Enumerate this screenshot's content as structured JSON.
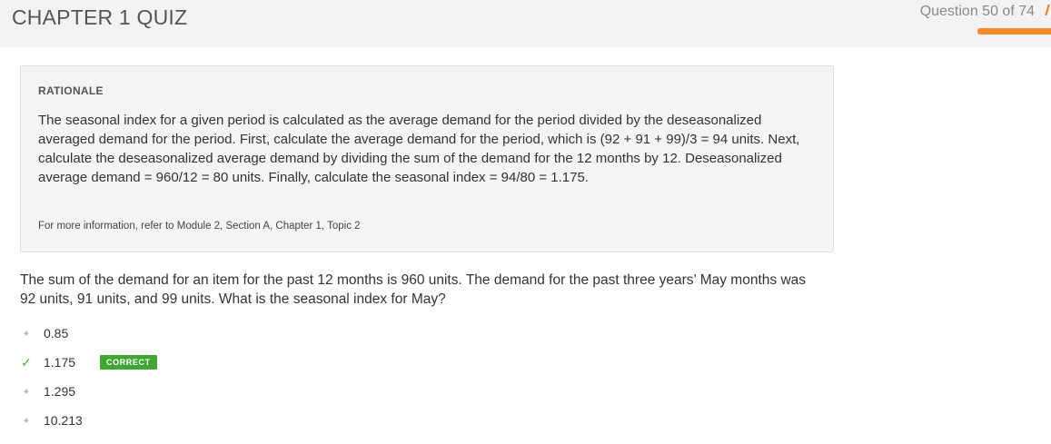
{
  "header": {
    "title": "CHAPTER 1 QUIZ",
    "progress_text": "Question 50 of 74",
    "progress_fraction": 0.676,
    "accent_color": "#f58a2a"
  },
  "rationale": {
    "label": "RATIONALE",
    "text": "The seasonal index for a given period is calculated as the average demand for the period divided by the deseasonalized averaged demand for the period. First, calculate the average demand for the period, which is (92 + 91 + 99)/3 = 94 units. Next, calculate the deseasonalized average demand by dividing the sum of the demand for the 12 months by 12. Deseasonalized average demand = 960/12 = 80 units. Finally, calculate the seasonal index = 94/80 = 1.175.",
    "reference": "For more information, refer to Module 2, Section A, Chapter 1, Topic 2"
  },
  "question": {
    "text": "The sum of the demand for an item for the past 12 months is 960 units. The demand for the past three years’ May months was 92 units, 91 units, and 99 units. What is the seasonal index for May?"
  },
  "options": [
    {
      "label": "0.85",
      "correct": false
    },
    {
      "label": "1.175",
      "correct": true,
      "badge": "CORRECT",
      "badge_color": "#3fa631"
    },
    {
      "label": "1.295",
      "correct": false
    },
    {
      "label": "10.213",
      "correct": false
    }
  ]
}
